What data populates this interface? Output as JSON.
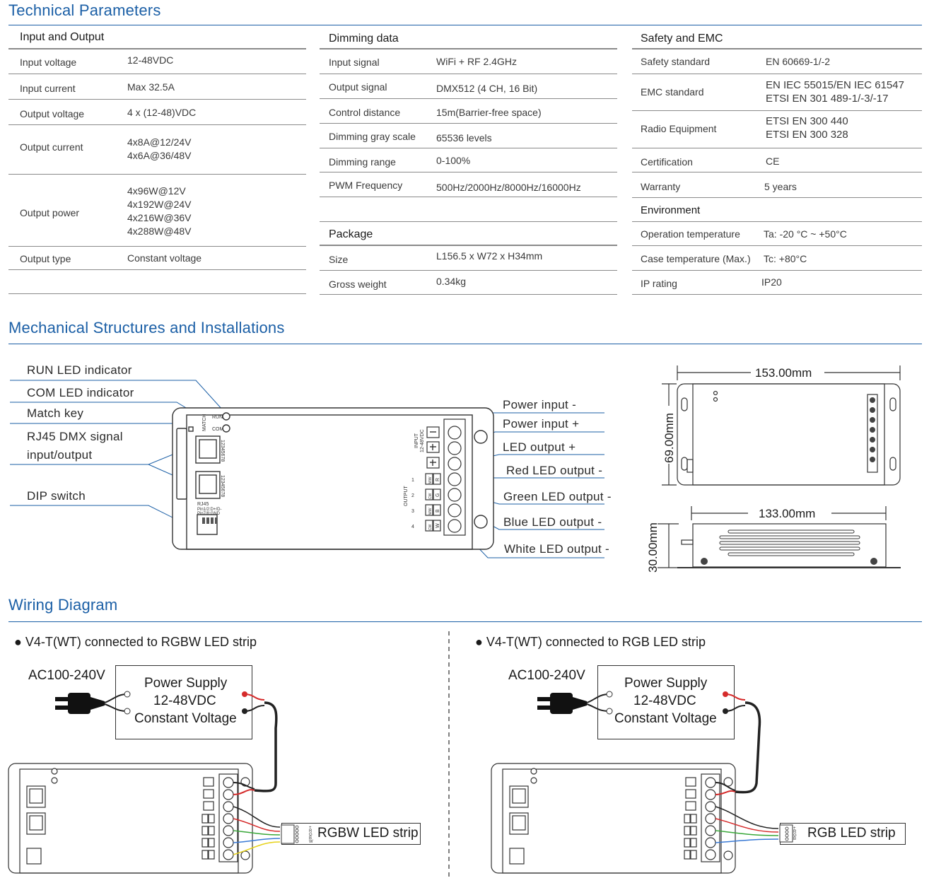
{
  "sections": {
    "technical": "Technical Parameters",
    "mechanical": "Mechanical Structures and Installations",
    "wiring": "Wiring Diagram"
  },
  "input_output": {
    "heading": "Input and Output",
    "rows": [
      {
        "k": "Input voltage",
        "v": [
          "12-48VDC"
        ]
      },
      {
        "k": "Input current",
        "v": [
          "Max 32.5A"
        ]
      },
      {
        "k": "Output voltage",
        "v": [
          "4 x (12-48)VDC"
        ]
      },
      {
        "k": "Output current",
        "v": [
          "4x8A@12/24V",
          "4x6A@36/48V"
        ]
      },
      {
        "k": "Output power",
        "v": [
          "4x96W@12V",
          "4x192W@24V",
          "4x216W@36V",
          "4x288W@48V"
        ]
      },
      {
        "k": "Output type",
        "v": [
          "Constant voltage"
        ]
      }
    ]
  },
  "dimming": {
    "heading": "Dimming data",
    "rows": [
      {
        "k": "Input signal",
        "v": "WiFi + RF 2.4GHz"
      },
      {
        "k": "Output signal",
        "v": "DMX512 (4 CH, 16 Bit)"
      },
      {
        "k": "Control distance",
        "v": "15m(Barrier-free space)"
      },
      {
        "k": "Dimming gray scale",
        "v": "65536 levels"
      },
      {
        "k": "Dimming range",
        "v": "0-100%"
      },
      {
        "k": "PWM Frequency",
        "v": "500Hz/2000Hz/8000Hz/16000Hz"
      }
    ]
  },
  "package": {
    "heading": "Package",
    "rows": [
      {
        "k": "Size",
        "v": "L156.5 x W72 x H34mm"
      },
      {
        "k": "Gross weight",
        "v": "0.34kg"
      }
    ]
  },
  "safety": {
    "heading": "Safety and EMC",
    "rows": [
      {
        "k": "Safety standard",
        "v": [
          "EN 60669-1/-2"
        ]
      },
      {
        "k": "EMC standard",
        "v": [
          "EN IEC 55015/EN IEC 61547",
          "ETSI EN 301 489-1/-3/-17"
        ]
      },
      {
        "k": "Radio Equipment",
        "v": [
          "ETSI EN 300 440",
          "ETSI EN 300 328"
        ]
      },
      {
        "k": "Certification",
        "v": [
          "CE"
        ]
      },
      {
        "k": "Warranty",
        "v": [
          "5 years"
        ]
      }
    ]
  },
  "environment": {
    "heading": "Environment",
    "rows": [
      {
        "k": "Operation temperature",
        "v": "Ta: -20 °C ~ +50°C"
      },
      {
        "k": "Case temperature (Max.)",
        "v": "Tc: +80°C"
      },
      {
        "k": "IP rating",
        "v": "IP20"
      }
    ]
  },
  "mechanical": {
    "left_labels": [
      "RUN LED indicator",
      "COM LED indicator",
      "Match key",
      "RJ45 DMX signal",
      "input/output",
      "DIP switch"
    ],
    "right_labels": [
      "Power input -",
      "Power input +",
      "LED output +",
      "Red LED output -",
      "Green LED output -",
      "Blue LED output -",
      "White LED output -"
    ],
    "dim_top": "153.00mm",
    "dim_side": "69.00mm",
    "dim_bottom": "133.00mm",
    "dim_height": "30.00mm",
    "device_run": "RUN",
    "device_com": "COM",
    "device_match": "MATCH",
    "device_input": "INPUT",
    "device_input_v": "12-48VDC",
    "device_output": "OUTPUT",
    "device_rj45": "RJ45",
    "device_pin1": "Pin1/2:D+/D-",
    "device_pin2": "Pin7/8:GND",
    "device_pins": "12345678",
    "channels": [
      "1",
      "2",
      "3",
      "4"
    ],
    "channel_tags": [
      "WW",
      "CW",
      "WW",
      "CW"
    ],
    "channel_letters": [
      "R",
      "G",
      "B",
      "W"
    ]
  },
  "wiring": {
    "left_title": "● V4-T(WT) connected to RGBW LED strip",
    "right_title": "● V4-T(WT) connected to RGB LED strip",
    "ac": "AC100-240V",
    "ps1": "Power Supply",
    "ps2": "12-48VDC",
    "ps3": "Constant Voltage",
    "left_strip": "RGBW LED strip",
    "right_strip": "RGB LED strip",
    "rgbw_pins": [
      "+",
      "R",
      "G",
      "B",
      "W"
    ],
    "rgb_pins": [
      "+",
      "R",
      "G",
      "B"
    ]
  },
  "colors": {
    "title_blue": "#1b5fa6",
    "rule_gray": "#8a8a8a",
    "wire_red": "#d52b2b",
    "wire_green": "#3aa83a",
    "wire_blue": "#3a7ad5",
    "wire_yellow": "#e7d21a"
  }
}
